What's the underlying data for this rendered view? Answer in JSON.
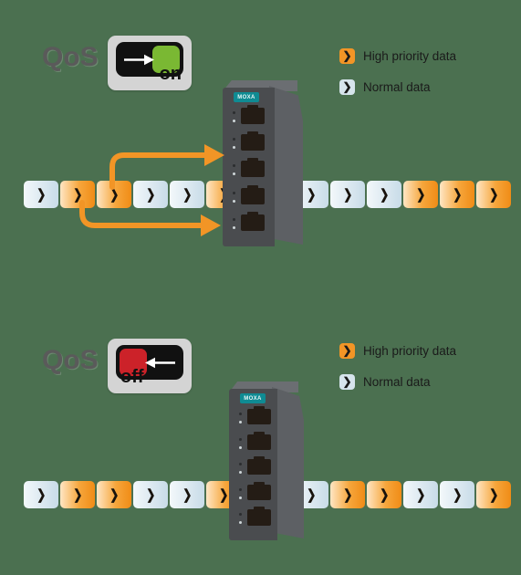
{
  "diagram": {
    "background_color": "#4b7050",
    "accent_orange": "#f29526",
    "accent_blue": "#d6e4ec",
    "toggle_on_color": "#7ab833",
    "toggle_off_color": "#cc2229"
  },
  "panels": [
    {
      "id": "qos-on",
      "qos_label": "QoS",
      "toggle_state": "on",
      "toggle_arrow_direction": "right",
      "legend": [
        {
          "label": "High priority data",
          "color": "#f29526",
          "chip": "chevron-right-icon"
        },
        {
          "label": "Normal data",
          "color": "#d6e4ec",
          "chip": "chevron-right-icon"
        }
      ],
      "device": {
        "brand": "MOXA",
        "port_count": 5
      },
      "stream_in": [
        "normal",
        "high",
        "high",
        "normal",
        "normal",
        "high"
      ],
      "stream_out": [
        "normal",
        "normal",
        "normal",
        "high",
        "high",
        "high"
      ],
      "priority_arrows": 2
    },
    {
      "id": "qos-off",
      "qos_label": "QoS",
      "toggle_state": "off",
      "toggle_arrow_direction": "left",
      "legend": [
        {
          "label": "High priority data",
          "color": "#f29526",
          "chip": "chevron-right-icon"
        },
        {
          "label": "Normal data",
          "color": "#d6e4ec",
          "chip": "chevron-right-icon"
        }
      ],
      "device": {
        "brand": "MOXA",
        "port_count": 5
      },
      "stream_in": [
        "normal",
        "high",
        "high",
        "normal",
        "normal",
        "high"
      ],
      "stream_out": [
        "normal",
        "high",
        "high",
        "normal",
        "normal",
        "high"
      ],
      "priority_arrows": 0
    }
  ]
}
